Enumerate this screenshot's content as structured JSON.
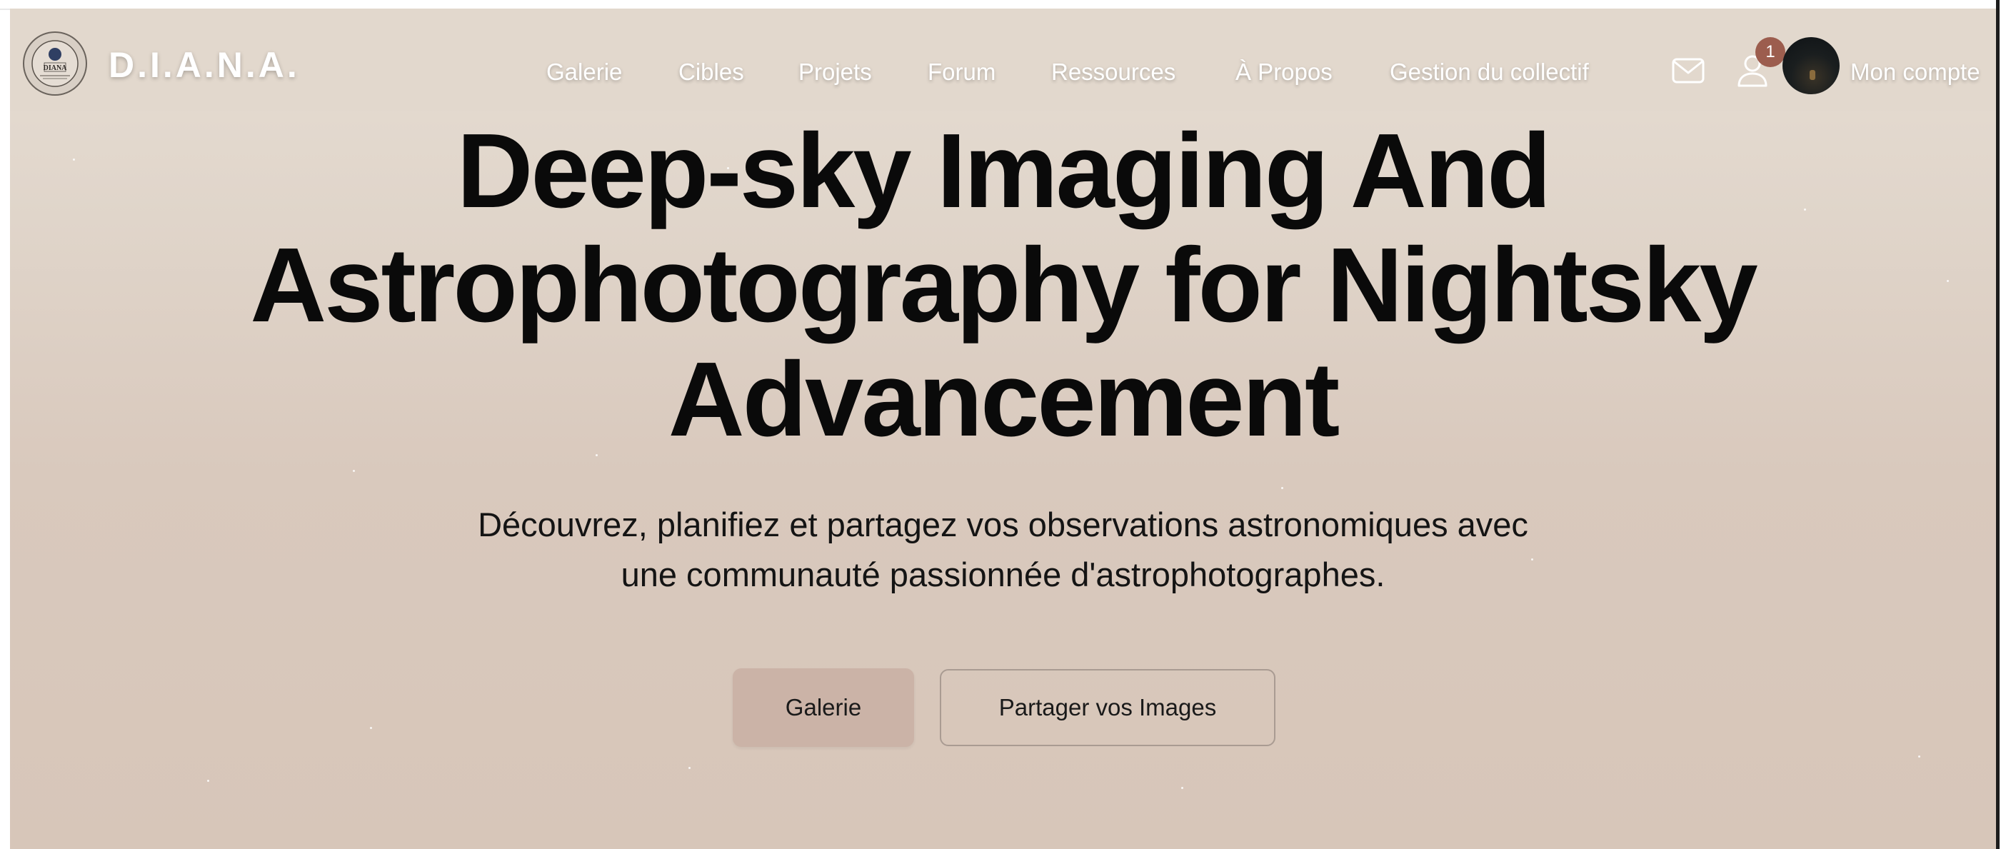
{
  "brand": {
    "name": "D.I.A.N.A.",
    "logo_text": "DIANA"
  },
  "nav": {
    "items": [
      {
        "label": "Galerie"
      },
      {
        "label": "Cibles"
      },
      {
        "label": "Projets"
      },
      {
        "label": "Forum"
      },
      {
        "label": "Ressources"
      },
      {
        "label": "À Propos"
      },
      {
        "label": "Gestion du collectif"
      }
    ],
    "notification_count": "1",
    "account_label": "Mon compte",
    "icons": [
      "mail-icon",
      "user-icon"
    ]
  },
  "hero": {
    "title_lines": [
      "Deep-sky Imaging And",
      "Astrophotography for Nightsky",
      "Advancement"
    ],
    "subtitle_lines": [
      "Découvrez, planifiez et partagez vos observations astronomiques avec",
      "une communauté passionnée d'astrophotographes."
    ],
    "primary_button": "Galerie",
    "secondary_button": "Partager vos Images"
  },
  "colors": {
    "background_top": "#e6ddd3",
    "background_bottom": "#d7c6b9",
    "primary_button": "#cbb3a7",
    "badge": "#9c5d4e",
    "title_text": "#0a0a0a"
  }
}
